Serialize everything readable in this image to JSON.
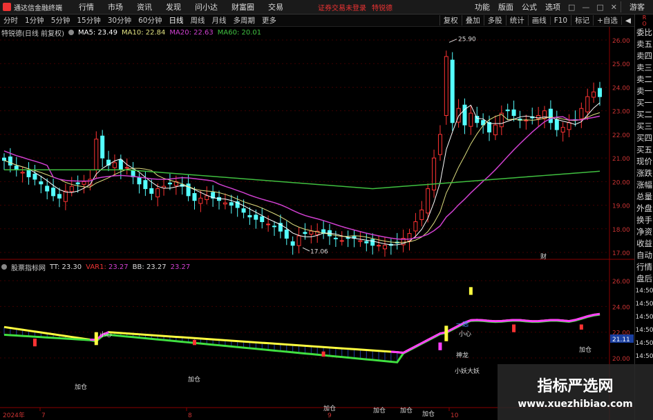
{
  "app": {
    "title": "通达信金融终端"
  },
  "menu": [
    "行情",
    "市场",
    "资讯",
    "发现",
    "问小达",
    "财富圈",
    "交易"
  ],
  "notice": "证券交易未登录",
  "stock_name": "特锐德",
  "menu_right": [
    "功能",
    "版面",
    "公式",
    "选项"
  ],
  "window_controls": [
    "□",
    "—",
    "□",
    "✕"
  ],
  "guest": "游客",
  "periods": [
    "分时",
    "1分钟",
    "5分钟",
    "15分钟",
    "30分钟",
    "60分钟",
    "日线",
    "周线",
    "月线",
    "多周期",
    "更多"
  ],
  "tools": [
    "复权",
    "叠加",
    "多股",
    "统计",
    "画线",
    "F10",
    "标记",
    "+自选",
    "◀"
  ],
  "main_legend": {
    "title": "特锐德(日线 前复权)",
    "ma5": "MA5: 23.49",
    "ma10": "MA10: 22.84",
    "ma20": "MA20: 22.63",
    "ma60": "MA60: 20.01"
  },
  "ind_legend": {
    "title": "股票指标网",
    "tt": "TT: 23.30",
    "var1_label": "VAR1: ",
    "var1_val": "23.27",
    "bb_label": "BB: 23.27",
    "bb_val": "23.27"
  },
  "right_panel": {
    "top": [
      "R",
      "O"
    ],
    "items": [
      "委比",
      "卖五",
      "卖四",
      "卖三",
      "卖二",
      "卖一",
      "买一",
      "买二",
      "买三",
      "买四",
      "买五",
      "现价",
      "涨跌",
      "涨幅",
      "总量",
      "外盘",
      "换手",
      "净资",
      "收益",
      "自动",
      "行情",
      "盘后",
      "14:50",
      "14:50",
      "14:50",
      "14:50",
      "14:50",
      "14:50"
    ]
  },
  "price_axis": [
    "26.00",
    "25.00",
    "24.00",
    "23.00",
    "22.00",
    "21.00",
    "20.00",
    "19.00",
    "18.00",
    "17.00"
  ],
  "ind_axis": [
    "26.00",
    "24.00",
    "22.00",
    "20.00"
  ],
  "ind_current": "21.11",
  "price_marks": {
    "high": "25.90",
    "low": "17.06",
    "cai": "财"
  },
  "annotations": {
    "xiaoxin": "小心",
    "jiacang": "加仓",
    "yiguo": "一选",
    "shenlong": "神龙",
    "xiaoyao": "小妖大妖"
  },
  "time_axis": [
    "2024年",
    "7",
    "8",
    "9",
    "10"
  ],
  "watermark": {
    "cn": "指标严选网",
    "en": "www.xuezhibiao.com"
  },
  "colors": {
    "up": "#ff3333",
    "down": "#54ffff",
    "ma5": "#ffffff",
    "ma10": "#e0e080",
    "ma20": "#d040d0",
    "ma60": "#40c040",
    "yellow": "#ffff40",
    "magenta": "#ff40ff",
    "green": "#40e040"
  }
}
